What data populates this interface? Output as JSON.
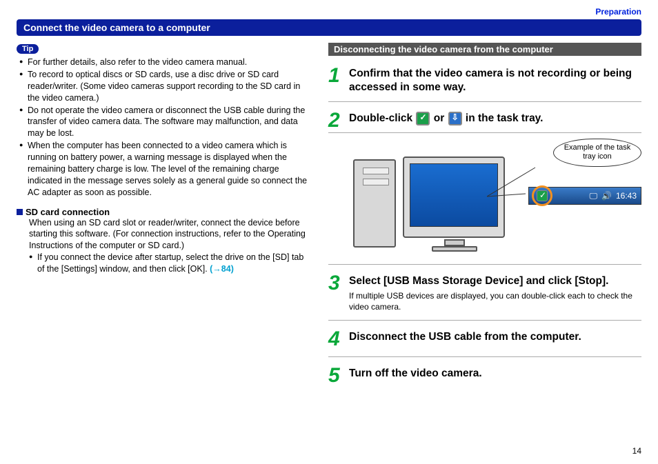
{
  "breadcrumb": "Preparation",
  "title": "Connect the video camera to a computer",
  "left": {
    "tip_label": "Tip",
    "bullets": [
      "For further details, also refer to the video camera manual.",
      "To record to optical discs or SD cards, use a disc drive or SD card reader/writer. (Some video cameras support recording to the SD card in the video camera.)",
      "Do not operate the video camera or disconnect the USB cable during the transfer of video camera data. The software may malfunction, and data may be lost.",
      "When the computer has been connected to a video camera which is running on battery power, a warning message is displayed when the remaining battery charge is low.  The level of the remaining charge indicated in the message serves solely as a general guide so connect the AC adapter as soon as possible."
    ],
    "sd_heading": "SD card connection",
    "sd_body": "When using an SD card slot or reader/writer, connect the device before starting this software. (For connection instructions, refer to the Operating Instructions of the computer or SD card.)",
    "sd_sub_bullet": "If you connect the device after startup, select the drive on the [SD] tab of the [Settings] window, and then click [OK]. ",
    "sd_link": "(→84)"
  },
  "right": {
    "section_title": "Disconnecting the video camera from the computer",
    "steps": [
      {
        "num": "1",
        "title": "Confirm that the video camera is not recording or being accessed in some way."
      },
      {
        "num": "2",
        "title_pre": "Double-click ",
        "title_mid": " or ",
        "title_post": " in the task tray."
      },
      {
        "num": "3",
        "title": "Select [USB Mass Storage Device] and click [Stop].",
        "note": "If multiple USB devices are displayed, you can double-click each to check the video camera."
      },
      {
        "num": "4",
        "title": "Disconnect the USB cable from the computer."
      },
      {
        "num": "5",
        "title": "Turn off the video camera."
      }
    ],
    "callout": "Example of the task tray icon",
    "taskbar_time": "16:43"
  },
  "page_number": "14"
}
